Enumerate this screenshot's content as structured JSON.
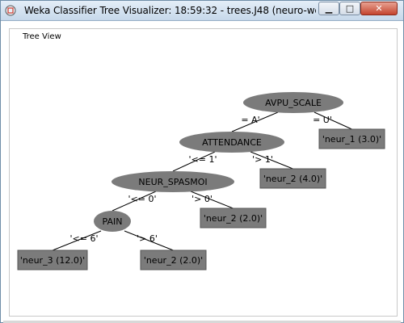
{
  "window": {
    "title": "Weka Classifier Tree Visualizer: 18:59:32 - trees.J48 (neuro-weka.fil...",
    "minimize_glyph": "▁",
    "maximize_glyph": "□",
    "close_glyph": "✕"
  },
  "group": {
    "label": "Tree View"
  },
  "tree": {
    "node_fill": "#7b7b7b",
    "nodes": [
      {
        "id": "n1",
        "label": "AVPU_SCALE",
        "shape": "ellipse"
      },
      {
        "id": "n2",
        "label": "ATTENDANCE",
        "shape": "ellipse"
      },
      {
        "id": "n3",
        "label": "NEUR_SPASMOI",
        "shape": "ellipse"
      },
      {
        "id": "n4",
        "label": "PAIN",
        "shape": "ellipse"
      },
      {
        "id": "l1",
        "label": "'neur_1 (3.0)'",
        "shape": "rect"
      },
      {
        "id": "l2",
        "label": "'neur_2 (4.0)'",
        "shape": "rect"
      },
      {
        "id": "l3",
        "label": "'neur_2 (2.0)'",
        "shape": "rect"
      },
      {
        "id": "l4",
        "label": "'neur_3 (12.0)'",
        "shape": "rect"
      },
      {
        "id": "l5",
        "label": "'neur_2 (2.0)'",
        "shape": "rect"
      }
    ],
    "edges": [
      {
        "from": "n1",
        "to": "n2",
        "label": "= A'"
      },
      {
        "from": "n1",
        "to": "l1",
        "label": "= U'"
      },
      {
        "from": "n2",
        "to": "n3",
        "label": "'<= 1'"
      },
      {
        "from": "n2",
        "to": "l2",
        "label": "'> 1'"
      },
      {
        "from": "n3",
        "to": "n4",
        "label": "'<= 0'"
      },
      {
        "from": "n3",
        "to": "l3",
        "label": "'> 0'"
      },
      {
        "from": "n4",
        "to": "l4",
        "label": "'<= 6'"
      },
      {
        "from": "n4",
        "to": "l5",
        "label": "'> 6'"
      }
    ]
  }
}
